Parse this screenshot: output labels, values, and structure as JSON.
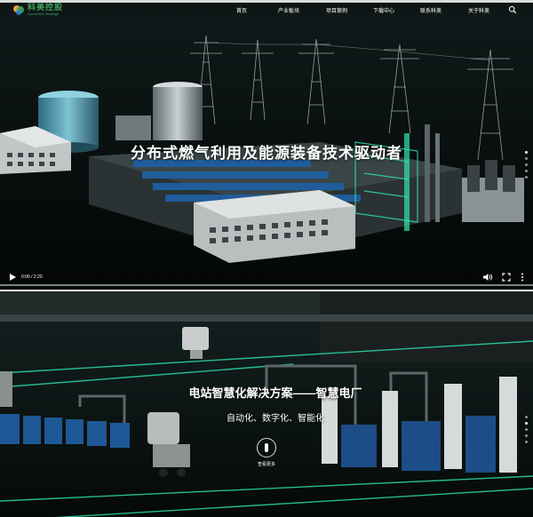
{
  "header": {
    "logo_cn": "科美控股",
    "logo_en": "Comethod Holdings",
    "nav": [
      {
        "label": "首页"
      },
      {
        "label": "产业板块"
      },
      {
        "label": "项目案例"
      },
      {
        "label": "下载中心"
      },
      {
        "label": "联系科美"
      },
      {
        "label": "关于科美"
      }
    ],
    "search_icon": "search-icon"
  },
  "hero": {
    "title": "分布式燃气利用及能源装备技术驱动者",
    "video": {
      "time": "0:00 / 2:20",
      "progress": 0
    },
    "slide_dots": 5
  },
  "section2": {
    "title": "电站智慧化解决方案——智慧电厂",
    "subtitle": "自动化、数字化、智能化",
    "view_more": "查看更多",
    "slide_dots": 5
  },
  "colors": {
    "brand_green": "#3ea35c",
    "accent_teal": "#2ee6b0"
  }
}
